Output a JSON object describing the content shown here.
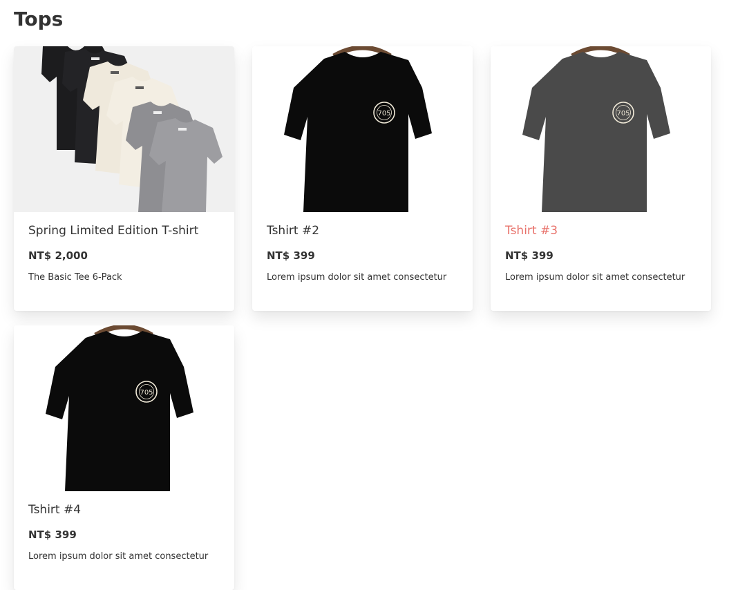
{
  "page": {
    "title": "Tops"
  },
  "colors": {
    "text": "#333333",
    "hover_title": "#e8716a",
    "shirt_black": "#0b0b0b",
    "shirt_charcoal": "#4a4a4a",
    "hanger": "#6b4a32",
    "badge": "#f1ead8"
  },
  "products": [
    {
      "name": "Spring Limited Edition T-shirt",
      "price": "NT$ 2,000",
      "description": "The Basic Tee 6-Pack",
      "image_icon": "tshirt-six-pack-icon",
      "badge": ""
    },
    {
      "name": "Tshirt #2",
      "price": "NT$ 399",
      "description": "Lorem ipsum dolor sit amet consectetur",
      "image_icon": "black-tshirt-icon",
      "badge": "705"
    },
    {
      "name": "Tshirt #3",
      "price": "NT$ 399",
      "description": "Lorem ipsum dolor sit amet consectetur",
      "image_icon": "charcoal-tshirt-icon",
      "badge": "705"
    },
    {
      "name": "Tshirt #4",
      "price": "NT$ 399",
      "description": "Lorem ipsum dolor sit amet consectetur",
      "image_icon": "black-tshirt-icon",
      "badge": "705"
    }
  ]
}
